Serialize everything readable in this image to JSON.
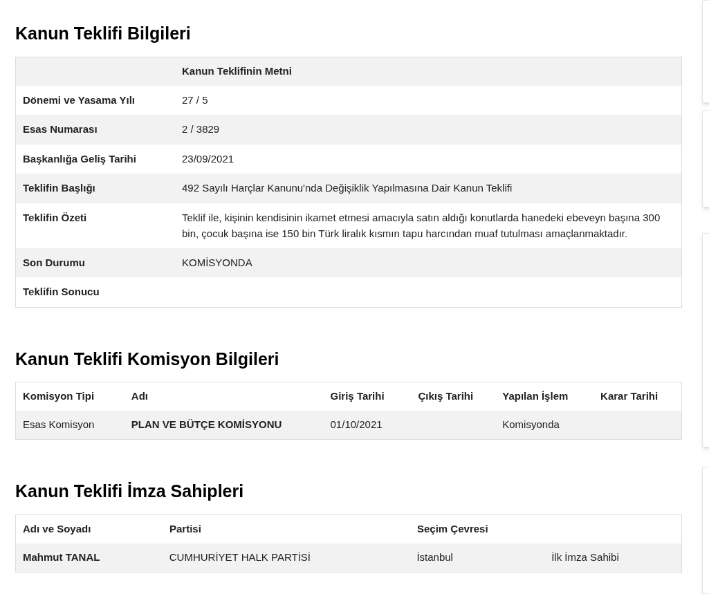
{
  "info": {
    "title": "Kanun Teklifi Bilgileri",
    "header": "Kanun Teklifinin Metni",
    "rows": [
      {
        "label": "Dönemi ve Yasama Yılı",
        "value": "27 / 5"
      },
      {
        "label": "Esas Numarası",
        "value": "2 / 3829"
      },
      {
        "label": "Başkanlığa Geliş Tarihi",
        "value": "23/09/2021"
      },
      {
        "label": "Teklifin Başlığı",
        "value": "492 Sayılı Harçlar Kanunu'nda Değişiklik Yapılmasına Dair Kanun Teklifi"
      },
      {
        "label": "Teklifin Özeti",
        "value": "Teklif ile, kişinin kendisinin ikamet etmesi amacıyla satın aldığı konutlarda hanedeki ebeveyn başına 300 bin, çocuk başına ise 150 bin Türk liralık kısmın tapu harcından muaf tutulması amaçlanmaktadır."
      },
      {
        "label": "Son Durumu",
        "value": "KOMİSYONDA"
      },
      {
        "label": "Teklifin Sonucu"
      }
    ]
  },
  "commission": {
    "title": "Kanun Teklifi Komisyon Bilgileri",
    "columns": [
      "Komisyon Tipi",
      "Adı",
      "Giriş Tarihi",
      "Çıkış Tarihi",
      "Yapılan İşlem",
      "Karar Tarihi"
    ],
    "rows": [
      [
        "Esas Komisyon",
        "PLAN VE BÜTÇE KOMİSYONU",
        "01/10/2021",
        "",
        "Komisyonda",
        ""
      ]
    ]
  },
  "signers": {
    "title": "Kanun Teklifi İmza Sahipleri",
    "columns": [
      "Adı ve Soyadı",
      "Partisi",
      "Seçim Çevresi"
    ],
    "rows": [
      [
        "Mahmut TANAL",
        "CUMHURİYET HALK PARTİSİ",
        "İstanbul",
        "İlk İmza Sahibi"
      ]
    ]
  }
}
